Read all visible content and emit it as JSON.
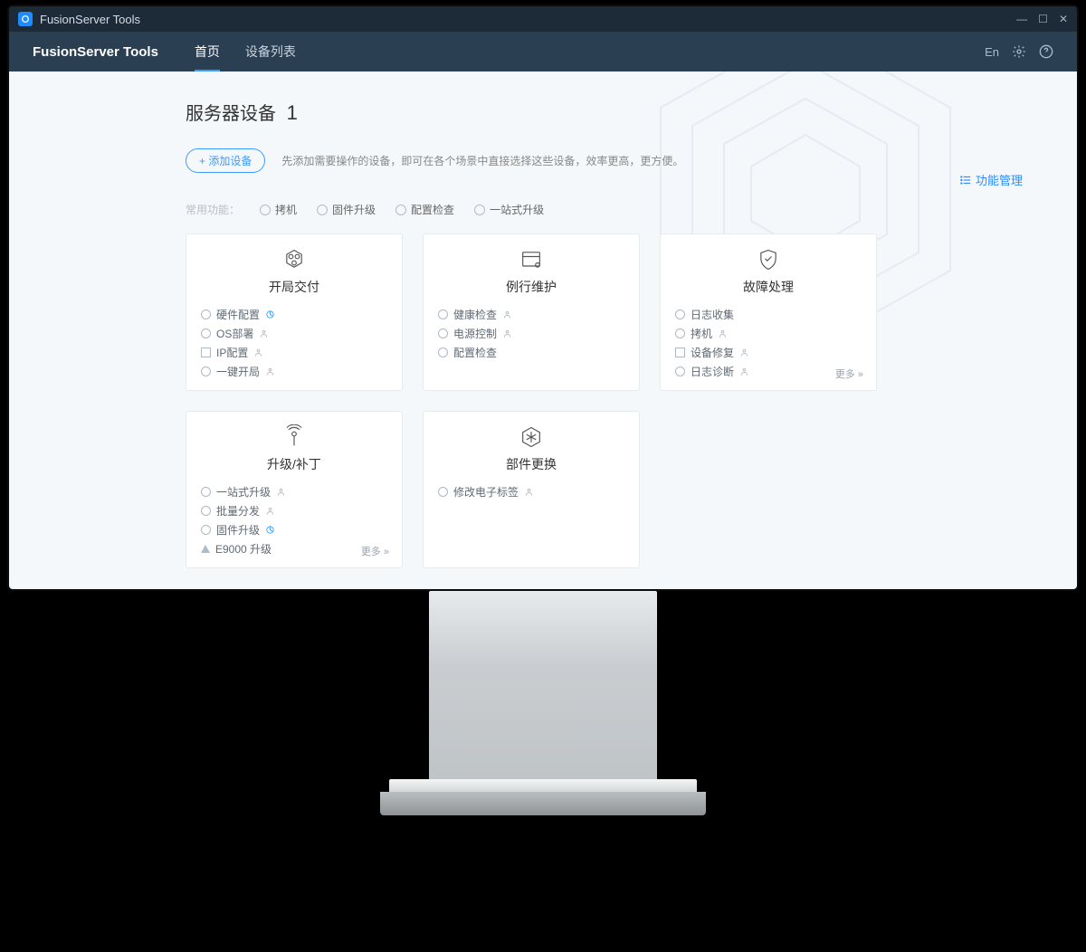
{
  "window": {
    "title": "FusionServer Tools"
  },
  "navbar": {
    "brand": "FusionServer Tools",
    "tabs": [
      {
        "label": "首页",
        "active": true
      },
      {
        "label": "设备列表",
        "active": false
      }
    ],
    "lang": "En"
  },
  "page": {
    "heading": "服务器设备",
    "count": "1",
    "add_btn": "+ 添加设备",
    "hint": "先添加需要操作的设备，即可在各个场景中直接选择这些设备，效率更高，更方便。",
    "func_mgmt": "功能管理"
  },
  "shortcuts": {
    "label": "常用功能：",
    "items": [
      "拷机",
      "固件升级",
      "配置检查",
      "一站式升级"
    ]
  },
  "cards": [
    {
      "title": "开局交付",
      "icon": "hex-icon",
      "items": [
        {
          "bullet": "radio",
          "label": "硬件配置",
          "aux": "pie"
        },
        {
          "bullet": "radio",
          "label": "OS部署",
          "aux": "person"
        },
        {
          "bullet": "square",
          "label": "IP配置",
          "aux": "person"
        },
        {
          "bullet": "radio",
          "label": "一键开局",
          "aux": "person"
        }
      ],
      "more": ""
    },
    {
      "title": "例行维护",
      "icon": "window-icon",
      "items": [
        {
          "bullet": "radio",
          "label": "健康检查",
          "aux": "person"
        },
        {
          "bullet": "radio",
          "label": "电源控制",
          "aux": "person"
        },
        {
          "bullet": "radio",
          "label": "配置检查",
          "aux": ""
        }
      ],
      "more": ""
    },
    {
      "title": "故障处理",
      "icon": "shield-icon",
      "items": [
        {
          "bullet": "radio",
          "label": "日志收集",
          "aux": ""
        },
        {
          "bullet": "radio",
          "label": "拷机",
          "aux": "person"
        },
        {
          "bullet": "square",
          "label": "设备修复",
          "aux": "person"
        },
        {
          "bullet": "radio",
          "label": "日志诊断",
          "aux": "person"
        }
      ],
      "more": "更多  »"
    },
    {
      "title": "升级/补丁",
      "icon": "antenna-icon",
      "items": [
        {
          "bullet": "radio",
          "label": "一站式升级",
          "aux": "person"
        },
        {
          "bullet": "radio",
          "label": "批量分发",
          "aux": "person"
        },
        {
          "bullet": "radio",
          "label": "固件升级",
          "aux": "pie"
        },
        {
          "bullet": "tri",
          "label": "E9000 升级",
          "aux": ""
        }
      ],
      "more": "更多  »"
    },
    {
      "title": "部件更换",
      "icon": "snow-icon",
      "items": [
        {
          "bullet": "radio",
          "label": "修改电子标签",
          "aux": "person"
        }
      ],
      "more": ""
    }
  ]
}
